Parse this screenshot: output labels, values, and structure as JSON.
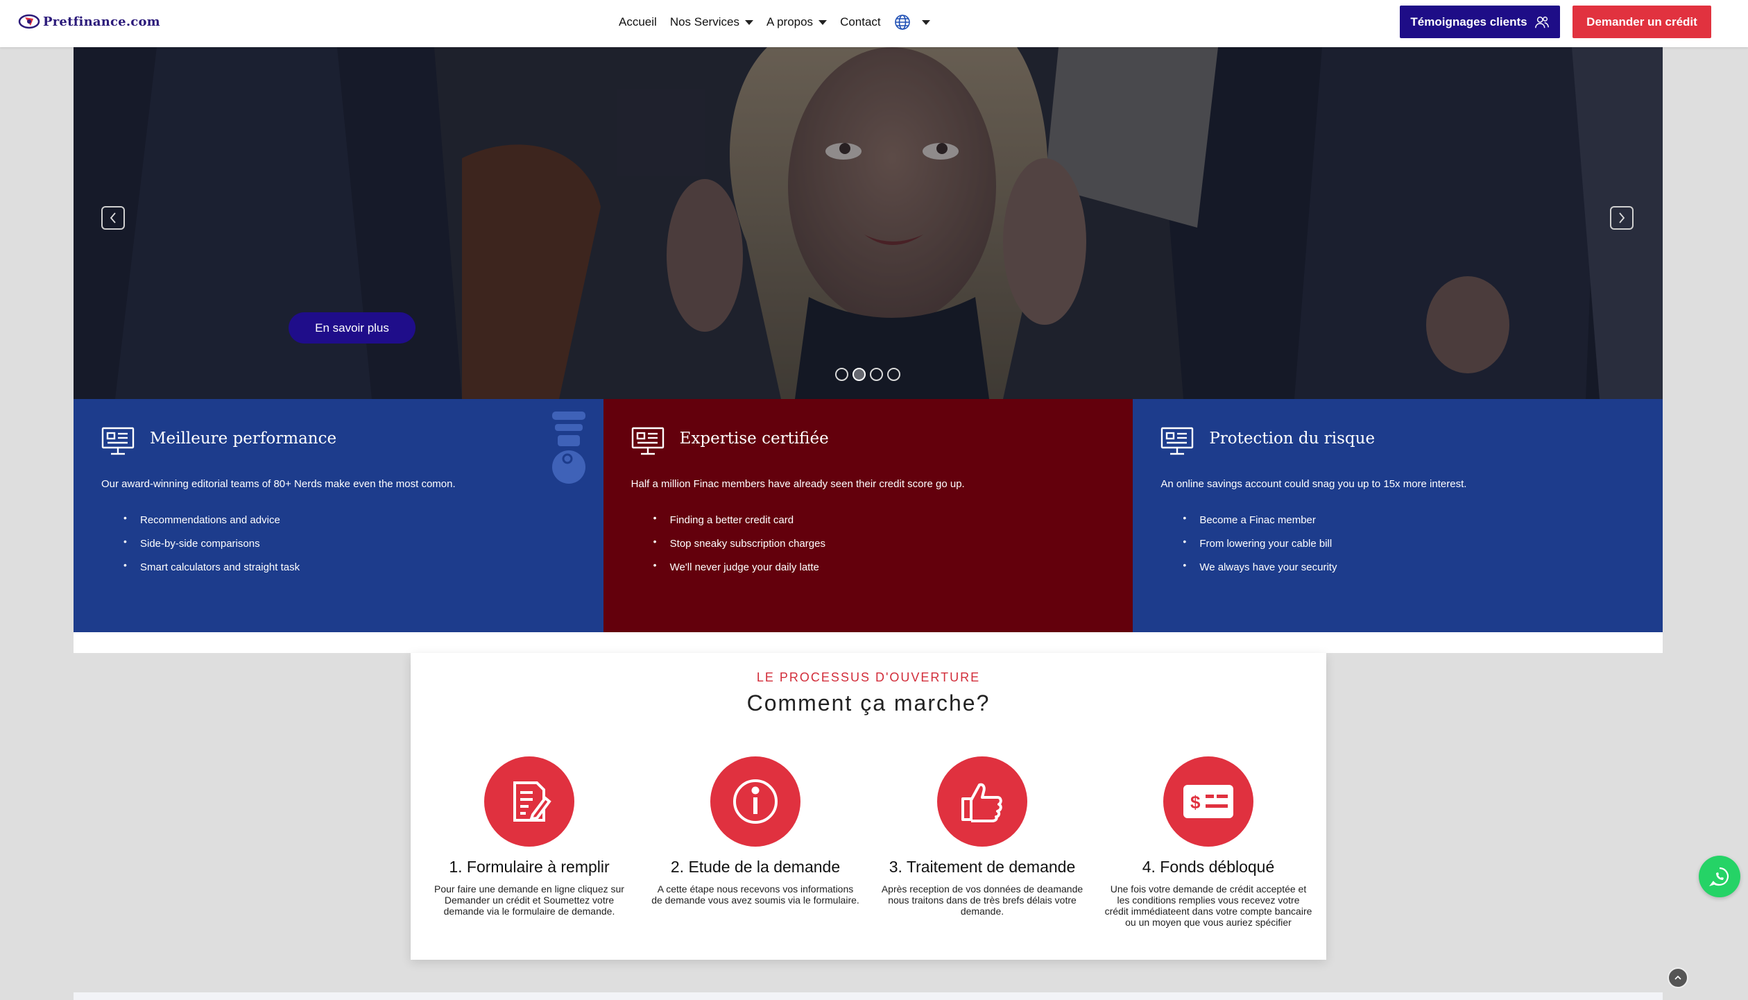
{
  "header": {
    "logo_text": "Pretfinance.com",
    "nav": [
      {
        "label": "Accueil"
      },
      {
        "label": "Nos Services"
      },
      {
        "label": "A propos"
      },
      {
        "label": "Contact"
      }
    ],
    "testimony_label": "Témoignages clients",
    "credit_label": "Demander un crédit"
  },
  "hero": {
    "button_label": "En savoir plus",
    "slide_count": 4,
    "active_slide": 2
  },
  "features": [
    {
      "title": "Meilleure performance",
      "desc": "Our award-winning editorial teams of 80+ Nerds make even the most comon.",
      "items": [
        "Recommendations and advice",
        "Side-by-side comparisons",
        "Smart calculators and straight task"
      ]
    },
    {
      "title": "Expertise certifiée",
      "desc": "Half a million Finac members have already seen their credit score go up.",
      "items": [
        "Finding a better credit card",
        "Stop sneaky subscription charges",
        "We'll never judge your daily latte"
      ]
    },
    {
      "title": "Protection du risque",
      "desc": "An online savings account could snag you up to 15x more interest.",
      "items": [
        "Become a Finac member",
        "From lowering your cable bill",
        "We always have your security"
      ]
    }
  ],
  "process": {
    "kicker": "LE PROCESSUS D'OUVERTURE",
    "title": "Comment ça marche?",
    "steps": [
      {
        "title": "1. Formulaire à remplir",
        "desc": "Pour faire une demande en ligne cliquez sur Demander un crédit et Soumettez votre demande via le formulaire de demande.",
        "icon": "form-icon"
      },
      {
        "title": "2. Etude de la demande",
        "desc": "A cette étape nous recevons vos informations de demande vous avez soumis via le formulaire.",
        "icon": "info-icon"
      },
      {
        "title": "3. Traitement de demande",
        "desc": "Après reception de vos données de deamande nous traitons dans de très brefs délais votre demande.",
        "icon": "thumbs-up-icon"
      },
      {
        "title": "4. Fonds débloqué",
        "desc": "Une fois votre demande de crédit acceptée et les conditions remplies vous recevez votre crédit immédiateent dans votre compte bancaire ou un moyen que vous auriez spécifier",
        "icon": "money-card-icon"
      }
    ]
  },
  "colors": {
    "brand_blue": "#1e0d87",
    "brand_red": "#e1323f",
    "feature_blue": "#1d3c8c",
    "feature_red": "#63000c"
  }
}
